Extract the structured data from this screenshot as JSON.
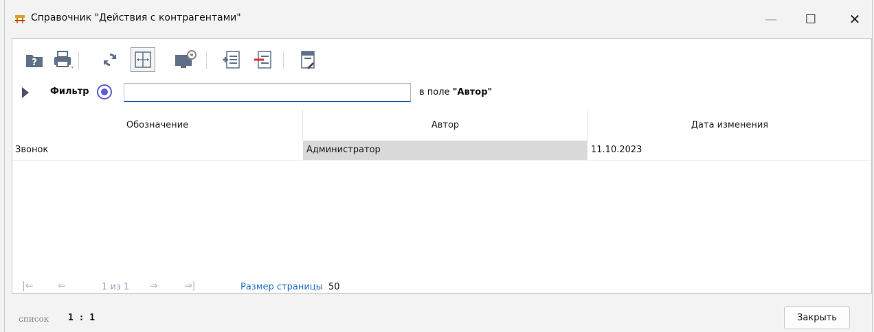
{
  "window": {
    "title": "Справочник \"Действия с контрагентами\"",
    "minimize_label": "—",
    "maximize_label": "☐",
    "close_label": "✕"
  },
  "toolbar": {
    "icons": [
      "help-folder-icon",
      "print-icon",
      "refresh-icon",
      "fit-columns-icon",
      "computer-settings-icon",
      "add-record-icon",
      "remove-record-icon",
      "export-icon"
    ]
  },
  "filter": {
    "label": "Фильтр",
    "input_value": "",
    "field_prefix": "в поле",
    "field_name": "\"Автор\""
  },
  "table": {
    "columns": [
      "Обозначение",
      "Автор",
      "Дата изменения"
    ],
    "rows": [
      [
        "Звонок",
        "Администратор",
        "11.10.2023"
      ]
    ]
  },
  "pager": {
    "first": "|⇐",
    "prev": "⇐",
    "position": "1 из 1",
    "next": "⇒",
    "last": "⇒|",
    "page_size_label": "Размер страницы",
    "page_size_value": "50"
  },
  "status": {
    "mode": "список",
    "value": "1 : 1"
  },
  "footer": {
    "close_button": "Закрыть"
  },
  "colors": {
    "accent": "#1a66b3",
    "radio": "#5b5bd6",
    "selected_cell": "#d9d9d9"
  }
}
